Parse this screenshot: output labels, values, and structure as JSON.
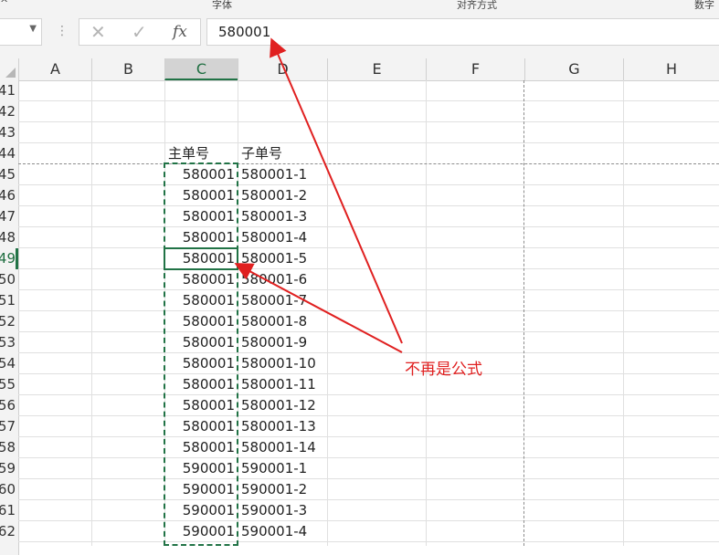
{
  "ribbon_fragments": [
    "^",
    "字体",
    "对齐方式",
    "数字"
  ],
  "formula_bar": {
    "value": "580001",
    "fx_label": "fx",
    "cancel_glyph": "✕",
    "enter_glyph": "✓"
  },
  "columns": [
    "A",
    "B",
    "C",
    "D",
    "E",
    "F",
    "G",
    "H"
  ],
  "selected_column": "C",
  "rows": [
    "41",
    "42",
    "43",
    "44",
    "45",
    "46",
    "47",
    "48",
    "49",
    "50",
    "51",
    "52",
    "53",
    "54",
    "55",
    "56",
    "57",
    "58",
    "59",
    "60",
    "61",
    "62"
  ],
  "selected_row": "49",
  "table": {
    "headers": [
      "主单号",
      "子单号"
    ],
    "main_numbers": [
      "580001",
      "580001",
      "580001",
      "580001",
      "580001",
      "580001",
      "580001",
      "580001",
      "580001",
      "580001",
      "580001",
      "580001",
      "580001",
      "580001",
      "590001",
      "590001",
      "590001",
      "590001"
    ],
    "sub_numbers": [
      "580001-1",
      "580001-2",
      "580001-3",
      "580001-4",
      "580001-5",
      "580001-6",
      "580001-7",
      "580001-8",
      "580001-9",
      "580001-10",
      "580001-11",
      "580001-12",
      "580001-13",
      "580001-14",
      "590001-1",
      "590001-2",
      "590001-3",
      "590001-4"
    ]
  },
  "annotation": {
    "text": "不再是公式",
    "color": "#e02020"
  },
  "colors": {
    "accent": "#217346",
    "header_bg": "#f3f3f3",
    "gridline": "#e0e0e0"
  }
}
